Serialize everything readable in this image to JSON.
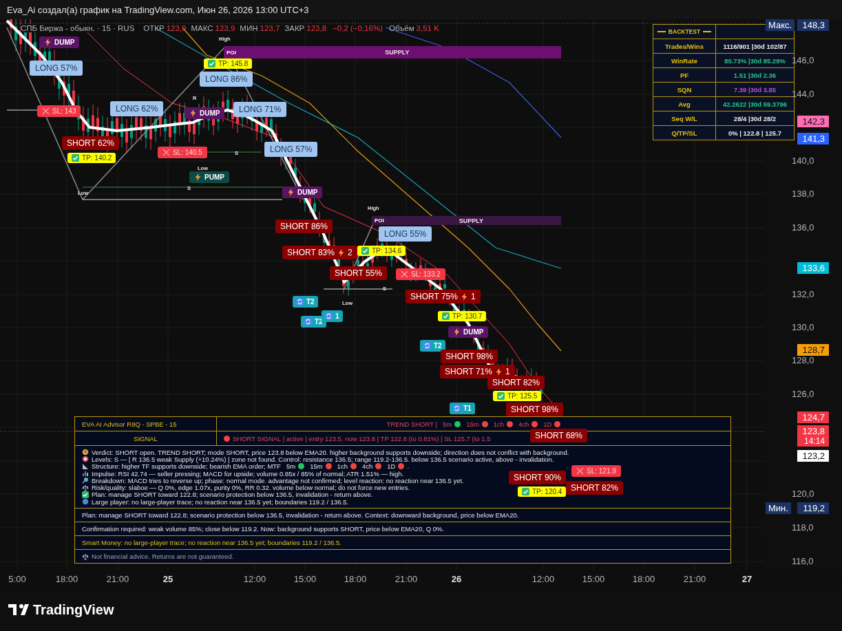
{
  "window": {
    "title": "Eva_Ai создал(а) график на TradingView.com, Июн 26, 2026 13:00 UTC+3"
  },
  "legend": {
    "symbol": "СПБ Биржа - обыкн. · 15 · RUS",
    "values": [
      {
        "label": "ОТКР",
        "value": "123,9"
      },
      {
        "label": "МАКС",
        "value": "123,9"
      },
      {
        "label": "МИН",
        "value": "123,7"
      },
      {
        "label": "ЗАКР",
        "value": "123,8"
      }
    ],
    "change": "−0,2 (−0,16%)",
    "volume_label": "Объём",
    "volume": "3,51 K"
  },
  "zones": [
    {
      "tag": "POI",
      "label": "SUPPLY"
    },
    {
      "tag": "POI",
      "label": "SUPPLY"
    }
  ],
  "notes": [
    "High",
    "High",
    "Low",
    "Low",
    "Low",
    "R",
    "S",
    "S",
    "S"
  ],
  "markers": [
    {
      "kind": "dump",
      "text": "DUMP"
    },
    {
      "kind": "long",
      "text": "LONG 57%"
    },
    {
      "kind": "sl",
      "text": "SL: 143"
    },
    {
      "kind": "long",
      "text": "LONG 62%"
    },
    {
      "kind": "short",
      "text": "SHORT 62%"
    },
    {
      "kind": "tp",
      "text": "TP: 140.2"
    },
    {
      "kind": "tp",
      "text": "TP: 145.8"
    },
    {
      "kind": "long",
      "text": "LONG 86%"
    },
    {
      "kind": "dump",
      "text": "DUMP"
    },
    {
      "kind": "long",
      "text": "LONG 71%"
    },
    {
      "kind": "sl",
      "text": "SL: 140.5"
    },
    {
      "kind": "long",
      "text": "LONG 57%"
    },
    {
      "kind": "pump",
      "text": "PUMP"
    },
    {
      "kind": "dump",
      "text": "DUMP"
    },
    {
      "kind": "short",
      "text": "SHORT 86%"
    },
    {
      "kind": "short",
      "text": "SHORT 83%",
      "count": "2"
    },
    {
      "kind": "long",
      "text": "LONG 55%"
    },
    {
      "kind": "tp",
      "text": "TP: 134.6"
    },
    {
      "kind": "short",
      "text": "SHORT 55%"
    },
    {
      "kind": "sl",
      "text": "SL: 133.2"
    },
    {
      "kind": "short",
      "text": "SHORT 75%",
      "count": "1"
    },
    {
      "kind": "tp",
      "text": "TP: 130.7"
    },
    {
      "kind": "dump",
      "text": "DUMP"
    },
    {
      "kind": "target",
      "text": "T2"
    },
    {
      "kind": "target",
      "text": "T2"
    },
    {
      "kind": "target",
      "text": "1"
    },
    {
      "kind": "target",
      "text": "T2"
    },
    {
      "kind": "short",
      "text": "SHORT 98%"
    },
    {
      "kind": "short",
      "text": "SHORT 71%",
      "count": "1"
    },
    {
      "kind": "short",
      "text": "SHORT 82%"
    },
    {
      "kind": "tp",
      "text": "TP: 125.5"
    },
    {
      "kind": "target",
      "text": "T1"
    },
    {
      "kind": "short",
      "text": "SHORT 98%"
    },
    {
      "kind": "short",
      "text": "SHORT 68%"
    },
    {
      "kind": "sl",
      "text": "SL: 121.9"
    },
    {
      "kind": "short",
      "text": "SHORT 90%"
    },
    {
      "kind": "tp",
      "text": "TP: 120.4"
    },
    {
      "kind": "short",
      "text": "SHORT 82%"
    }
  ],
  "backtest": {
    "title": "BACKTEST",
    "rows": [
      {
        "label": "Trades/Wins",
        "value": "1116/901 |30d 102/87",
        "color": "#eeeeee"
      },
      {
        "label": "WinRate",
        "value": "80.73% |30d 85.29%",
        "color": "#22c98a"
      },
      {
        "label": "PF",
        "value": "1.51 |30d 2.36",
        "color": "#22c98a"
      },
      {
        "label": "SQN",
        "value": "7.39 |30d 3.85",
        "color": "#b450e0"
      },
      {
        "label": "Avg",
        "value": "42.2622 |30d 59.3796",
        "color": "#22c98a"
      },
      {
        "label": "Seq W/L",
        "value": "28/4 |30d 28/2",
        "color": "#eeeeee"
      },
      {
        "label": "Q/TP/SL",
        "value": "0% | 122.8 | 125.7",
        "color": "#eeeeee"
      }
    ]
  },
  "advisor": {
    "title": "EVA AI Advisor R8Q - SPBE - 15",
    "trend": "TREND SHORT | ",
    "trend_frames": [
      {
        "label": "5m",
        "color": "#22c55e"
      },
      {
        "label": "15m",
        "color": "#ef4444"
      },
      {
        "label": "1ch",
        "color": "#ef4444"
      },
      {
        "label": "4ch",
        "color": "#ef4444"
      },
      {
        "label": "1D",
        "color": "#ef4444"
      }
    ],
    "signal_label": "SIGNAL",
    "signal": {
      "color": "#ef4444",
      "text": "SHORT SIGNAL | active | entry 123.5, now 123.8 | TP 122.8 (to 0.81%) | SL 125.7 (to 1.5"
    },
    "details": [
      {
        "kind": "verdict",
        "text": "Verdict: SHORT open. TREND SHORT; mode SHORT, price 123.8 below EMA20. higher background supports downside; direction does not conflict with background."
      },
      {
        "kind": "levels",
        "text": "Levels: S — | R 136.5 weak Supply (+10.24%) | zone not found. Control: resistance 136.5; range 119.2-136.5. below 136.5 scenario active, above - invalidation."
      },
      {
        "kind": "structure",
        "text": "Structure: higher TF supports downside; bearish EMA order; MTF",
        "frames": [
          {
            "label": "5m",
            "color": "#22c55e"
          },
          {
            "label": "15m",
            "color": "#ef4444"
          },
          {
            "label": "1ch",
            "color": "#ef4444"
          },
          {
            "label": "4ch",
            "color": "#ef4444"
          },
          {
            "label": "1D",
            "color": "#ef4444"
          }
        ],
        "suffix": "."
      },
      {
        "kind": "impulse",
        "text": "Impulse: RSI 42.74 — seller pressing; MACD for upside; volume 0.85x / 85% of normal; ATR 1.51% — high."
      },
      {
        "kind": "breakdown",
        "text": "Breakdown: MACD tries to reverse up; phase: normal mode. advantage not confirmed; level reaction: no reaction near 136.5 yet."
      },
      {
        "kind": "risk",
        "text": "Risk/quality: slaboe — Q 0%, edge 1.07x, purity 0%, RR 0.32. volume below normal; do not force new entries."
      },
      {
        "kind": "plan",
        "text": "Plan: manage SHORT toward 122.8; scenario protection below 136.5, invalidation - return above."
      },
      {
        "kind": "player",
        "text": "Large player: no large-player trace; no reaction near 136.5 yet; boundaries 119.2 / 136.5."
      }
    ],
    "rows": [
      {
        "kind": "plain",
        "text": "Plan: manage SHORT toward 122.8; scenario protection below 136.5, invalidation - return above. Context: downward background, price below EMA20."
      },
      {
        "kind": "plain",
        "text": "Confirmation required: weak volume 85%; close below 119.2. Now: background supports SHORT, price below EMA20, Q 0%."
      },
      {
        "kind": "highlight",
        "text": "Smart Money: no large-player trace; no reaction near 136.5 yet; boundaries 119.2 / 136.5."
      },
      {
        "kind": "disclaimer",
        "text": "Not financial advice. Returns are not guaranteed."
      }
    ]
  },
  "price_axis": [
    {
      "kind": "tag",
      "caption": "Макс.",
      "text": "148,3",
      "color": "#1c3366"
    },
    {
      "kind": "tick",
      "text": "146,0"
    },
    {
      "kind": "tick",
      "text": "144,0"
    },
    {
      "kind": "tag",
      "text": "142,3",
      "color": "#ff6eb4"
    },
    {
      "kind": "tag",
      "text": "141,3",
      "color": "#2962ff"
    },
    {
      "kind": "tick",
      "text": "140,0"
    },
    {
      "kind": "tick",
      "text": "138,0"
    },
    {
      "kind": "tick",
      "text": "136,0"
    },
    {
      "kind": "tag",
      "text": "133,6",
      "color": "#00bcd4"
    },
    {
      "kind": "tick",
      "text": "132,0"
    },
    {
      "kind": "tick",
      "text": "130,0"
    },
    {
      "kind": "tag",
      "text": "128,7",
      "color": "#f59e0b"
    },
    {
      "kind": "tick",
      "text": "128,0"
    },
    {
      "kind": "tick",
      "text": "126,0"
    },
    {
      "kind": "tag",
      "text": "124,7",
      "color": "#f23645"
    },
    {
      "kind": "tag",
      "text": "123,8",
      "sub": "14:14",
      "color": "#f23645"
    },
    {
      "kind": "tag",
      "text": "123,2",
      "color": "#ffffff"
    },
    {
      "kind": "tick",
      "text": "120,0"
    },
    {
      "kind": "tag",
      "caption": "Мин.",
      "text": "119,2",
      "color": "#1c3366"
    },
    {
      "kind": "tick",
      "text": "118,0"
    },
    {
      "kind": "tick",
      "text": "116,0"
    }
  ],
  "time_axis": [
    {
      "kind": "time",
      "text": "5:00"
    },
    {
      "kind": "time",
      "text": "18:00"
    },
    {
      "kind": "time",
      "text": "21:00"
    },
    {
      "kind": "day",
      "text": "25"
    },
    {
      "kind": "time",
      "text": "12:00"
    },
    {
      "kind": "time",
      "text": "15:00"
    },
    {
      "kind": "time",
      "text": "18:00"
    },
    {
      "kind": "time",
      "text": "21:00"
    },
    {
      "kind": "day",
      "text": "26"
    },
    {
      "kind": "time",
      "text": "12:00"
    },
    {
      "kind": "time",
      "text": "15:00"
    },
    {
      "kind": "time",
      "text": "18:00"
    },
    {
      "kind": "time",
      "text": "21:00"
    },
    {
      "kind": "day",
      "text": "27"
    }
  ],
  "footer": {
    "brand": "TradingView"
  }
}
